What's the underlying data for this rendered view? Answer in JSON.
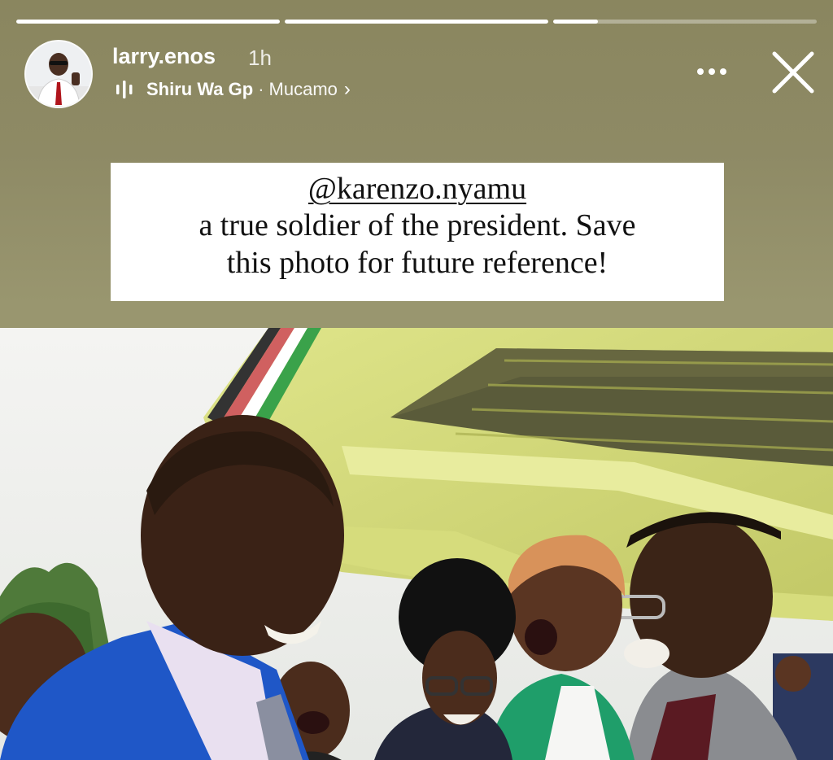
{
  "story": {
    "progress_segments": [
      {
        "fill": 1.0
      },
      {
        "fill": 1.0
      },
      {
        "fill": 0.17
      }
    ]
  },
  "header": {
    "username": "larry.enos",
    "time_ago": "1h",
    "music": {
      "icon": "music-bars-icon",
      "song": "Shiru Wa Gp",
      "separator": "·",
      "artist": "Mucamo",
      "chevron": "›"
    },
    "more_icon": "more-horizontal-icon",
    "close_icon": "close-icon"
  },
  "caption": {
    "mention": "@karenzo.nyamu",
    "line1": "a true soldier of the president. Save",
    "line2": "this photo for future reference!"
  },
  "colors": {
    "background": "#8f8a68",
    "canopy": "#cfd67a",
    "blazer_blue": "#1f57c7",
    "jacket_green": "#1f9e6a"
  }
}
